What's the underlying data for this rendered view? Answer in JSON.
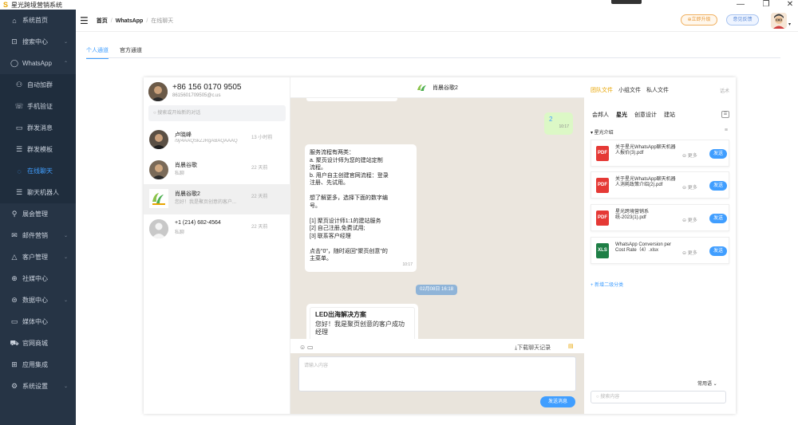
{
  "app": {
    "title": "星光跨境营销系统",
    "logo_glyph": "S"
  },
  "window_controls": {
    "minimize": "—",
    "restore": "❐",
    "close": "✕"
  },
  "sidebar": {
    "items": [
      {
        "label": "系统首页",
        "icon": "home-icon",
        "glyph": "⌂"
      },
      {
        "label": "搜索中心",
        "icon": "search-center-icon",
        "glyph": "⊡",
        "arrow": "⌄"
      },
      {
        "label": "WhatsApp",
        "icon": "whatsapp-icon",
        "glyph": "◯",
        "arrow": "⌃"
      },
      {
        "label": "自动加群",
        "icon": "user-icon",
        "glyph": "⚇",
        "sub": true
      },
      {
        "label": "手机验证",
        "icon": "phone-check-icon",
        "glyph": "☏",
        "sub": true
      },
      {
        "label": "群发消息",
        "icon": "message-icon",
        "glyph": "▭",
        "sub": true
      },
      {
        "label": "群发模板",
        "icon": "template-icon",
        "glyph": "☰",
        "sub": true
      },
      {
        "label": "在线聊天",
        "icon": "chat-icon",
        "glyph": "◌",
        "sub": true,
        "active": true
      },
      {
        "label": "聊天机器人",
        "icon": "robot-icon",
        "glyph": "☰",
        "sub": true
      },
      {
        "label": "展会管理",
        "icon": "location-icon",
        "glyph": "⚲"
      },
      {
        "label": "邮件营销",
        "icon": "mail-icon",
        "glyph": "✉",
        "arrow": "⌄"
      },
      {
        "label": "客户管理",
        "icon": "customer-icon",
        "glyph": "△",
        "arrow": "⌄"
      },
      {
        "label": "社媒中心",
        "icon": "social-icon",
        "glyph": "⊕"
      },
      {
        "label": "数据中心",
        "icon": "data-icon",
        "glyph": "⊜",
        "arrow": "⌄"
      },
      {
        "label": "媒体中心",
        "icon": "folder-icon",
        "glyph": "▭"
      },
      {
        "label": "官网商城",
        "icon": "cart-icon",
        "glyph": "⛟"
      },
      {
        "label": "应用集成",
        "icon": "apps-icon",
        "glyph": "⊞"
      },
      {
        "label": "系统设置",
        "icon": "settings-icon",
        "glyph": "⚙",
        "arrow": "⌄"
      }
    ]
  },
  "header": {
    "breadcrumb": [
      "首页",
      "WhatsApp",
      "在线聊天"
    ],
    "upgrade_label": "⊕立即升级",
    "feedback_label": "意见反馈"
  },
  "tabs": [
    "个人通道",
    "官方通道"
  ],
  "account": {
    "phone": "+86 156 0170 9505",
    "email": "8615601709505@c.us"
  },
  "search": {
    "placeholder": "搜索或开始新的对话"
  },
  "contacts": [
    {
      "name": "卢晓峰",
      "preview": "/9j/4AAQSkZJRgABAQAAAQ",
      "time": "13 小时前"
    },
    {
      "name": "肖晨谷歌",
      "preview": "私聊",
      "time": "22 天前"
    },
    {
      "name": "肖晨谷歌2",
      "preview": "您好！我是聚页创意的客户...",
      "time": "22 天前",
      "selected": true
    },
    {
      "name": "+1 (214) 682-4564",
      "preview": "私聊",
      "time": "22 天前"
    }
  ],
  "chat": {
    "title": "肖晨谷歌2",
    "outgoing": {
      "text": "2",
      "time": "10:17"
    },
    "incoming": {
      "lines": [
        "服务流程有两类：",
        "a. 聚页设计师为您的建站定制",
        "流程。",
        "b. 用户自主创建官网流程：登录",
        "注册、先试用。",
        "",
        "想了解更多，选择下面的数字编",
        "号。",
        "",
        "[1] 聚页设计师1:1的建站服务",
        "[2] 自己注册,免费试用;",
        "[3] 联系客户经理",
        "",
        "点击\"0\"，随时返回\"聚页创意\"的",
        "主菜单。"
      ],
      "time": "10:17"
    },
    "date_divider": "02月08日 16:18",
    "card": {
      "title": "LED出海解决方案",
      "text": "您好！我是聚页创意的客户成功经理"
    },
    "download_label": "⤓下载聊天记录",
    "input_placeholder": "请输入内容",
    "send_label": "发送消息"
  },
  "right": {
    "tabs": [
      "团队文件",
      "小组文件",
      "私人文件"
    ],
    "more": "话术",
    "subtabs": [
      "会邦人",
      "星光",
      "创意设计",
      "建站"
    ],
    "category": "▾ 星光介绍",
    "files": [
      {
        "name": "关于星光WhatsApp聊天机器人报价(3).pdf",
        "type": "pdf"
      },
      {
        "name": "关于星光WhatsApp聊天机器人消耗政策介绍(2).pdf",
        "type": "pdf"
      },
      {
        "name": "星光跨境营销系统-2023(1).pdf",
        "type": "pdf"
      },
      {
        "name": "WhatsApp Conversion per Cost Rate（4）.xlsx",
        "type": "xlsx"
      }
    ],
    "more_label": "⊖ 更多",
    "send_label": "发送",
    "add_category": "+ 新增二级分类",
    "phrases": "常用语 ⌄",
    "search_placeholder": "搜索内容"
  }
}
